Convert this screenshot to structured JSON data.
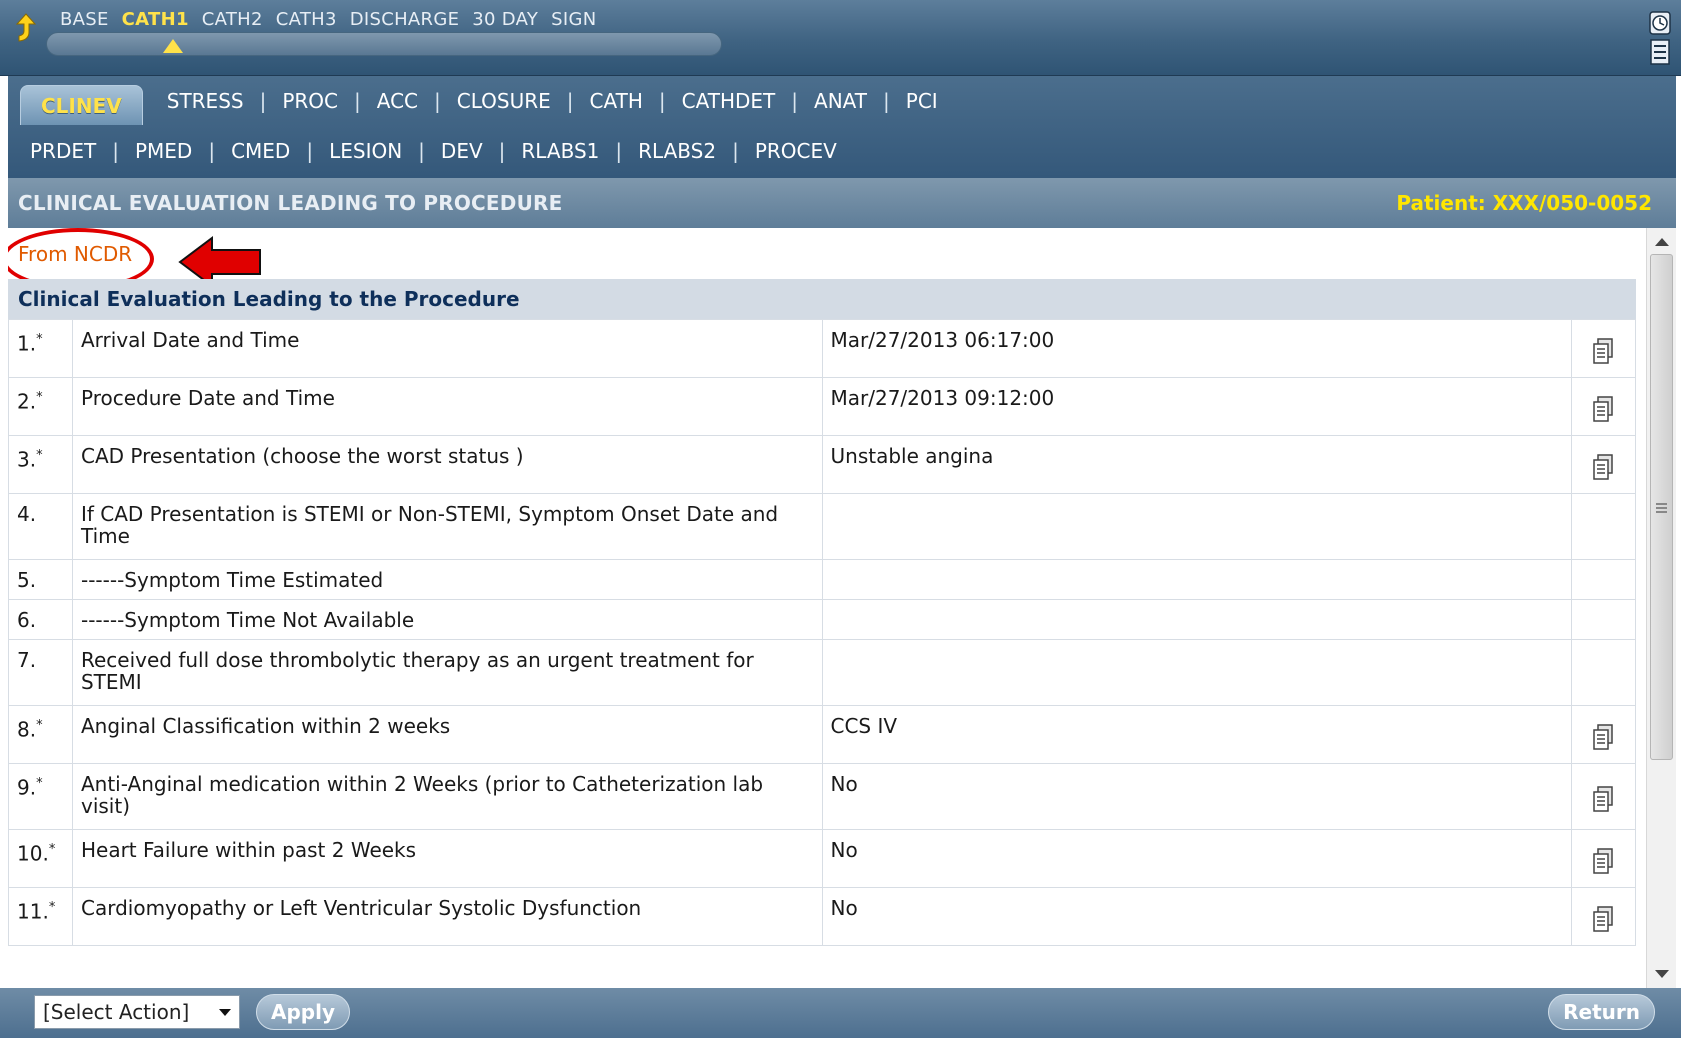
{
  "stages": {
    "items": [
      "BASE",
      "CATH1",
      "CATH2",
      "CATH3",
      "DISCHARGE",
      "30 DAY",
      "SIGN"
    ],
    "active": "CATH1"
  },
  "tabs": {
    "active": "CLINEV",
    "row1": [
      "STRESS",
      "PROC",
      "ACC",
      "CLOSURE",
      "CATH",
      "CATHDET",
      "ANAT",
      "PCI"
    ],
    "row2": [
      "PRDET",
      "PMED",
      "CMED",
      "LESION",
      "DEV",
      "RLABS1",
      "RLABS2",
      "PROCEV"
    ],
    "separator": "|"
  },
  "section": {
    "title": "CLINICAL EVALUATION LEADING TO PROCEDURE",
    "patient": "Patient: XXX/050-0052"
  },
  "content": {
    "source_note": "From NCDR",
    "group_title": "Clinical Evaluation Leading to the Procedure",
    "rows": [
      {
        "num": "1.",
        "required": true,
        "question": "Arrival Date and Time",
        "answer": "Mar/27/2013 06:17:00",
        "has_copy": true
      },
      {
        "num": "2.",
        "required": true,
        "question": "Procedure Date and Time",
        "answer": "Mar/27/2013 09:12:00",
        "has_copy": true
      },
      {
        "num": "3.",
        "required": true,
        "question": "CAD Presentation (choose the worst status )",
        "answer": "Unstable angina",
        "has_copy": true
      },
      {
        "num": "4.",
        "required": false,
        "question": "If CAD Presentation is STEMI or Non-STEMI, Symptom Onset Date and Time",
        "answer": "",
        "has_copy": false
      },
      {
        "num": "5.",
        "required": false,
        "question": "------Symptom Time Estimated",
        "answer": "",
        "has_copy": false
      },
      {
        "num": "6.",
        "required": false,
        "question": "------Symptom Time Not Available",
        "answer": "",
        "has_copy": false
      },
      {
        "num": "7.",
        "required": false,
        "question": "Received full dose thrombolytic therapy as an urgent treatment for STEMI",
        "answer": "",
        "has_copy": false
      },
      {
        "num": "8.",
        "required": true,
        "question": "Anginal Classification within 2 weeks",
        "answer": "CCS IV",
        "has_copy": true
      },
      {
        "num": "9.",
        "required": true,
        "question": "Anti-Anginal medication within 2 Weeks (prior to Catheterization lab visit)",
        "answer": "No",
        "has_copy": true
      },
      {
        "num": "10.",
        "required": true,
        "question": "Heart Failure within past 2 Weeks",
        "answer": "No",
        "has_copy": true
      },
      {
        "num": "11.",
        "required": true,
        "question": "Cardiomyopathy or Left Ventricular Systolic Dysfunction",
        "answer": "No",
        "has_copy": true
      }
    ],
    "required_marker": "*"
  },
  "footer": {
    "select_action": "[Select Action]",
    "apply_label": "Apply",
    "return_label": "Return"
  },
  "colors": {
    "header_blue": "#3f6382",
    "active_yellow": "#ffe24a",
    "ncdr_orange": "#e05a00",
    "annotation_red": "#e00000",
    "group_text": "#0e2f5a"
  },
  "icons": {
    "top_left": "up-arrow-icon",
    "top_right": [
      "clock-icon",
      "menu-icon"
    ],
    "row_action": "copy-document-icon"
  }
}
